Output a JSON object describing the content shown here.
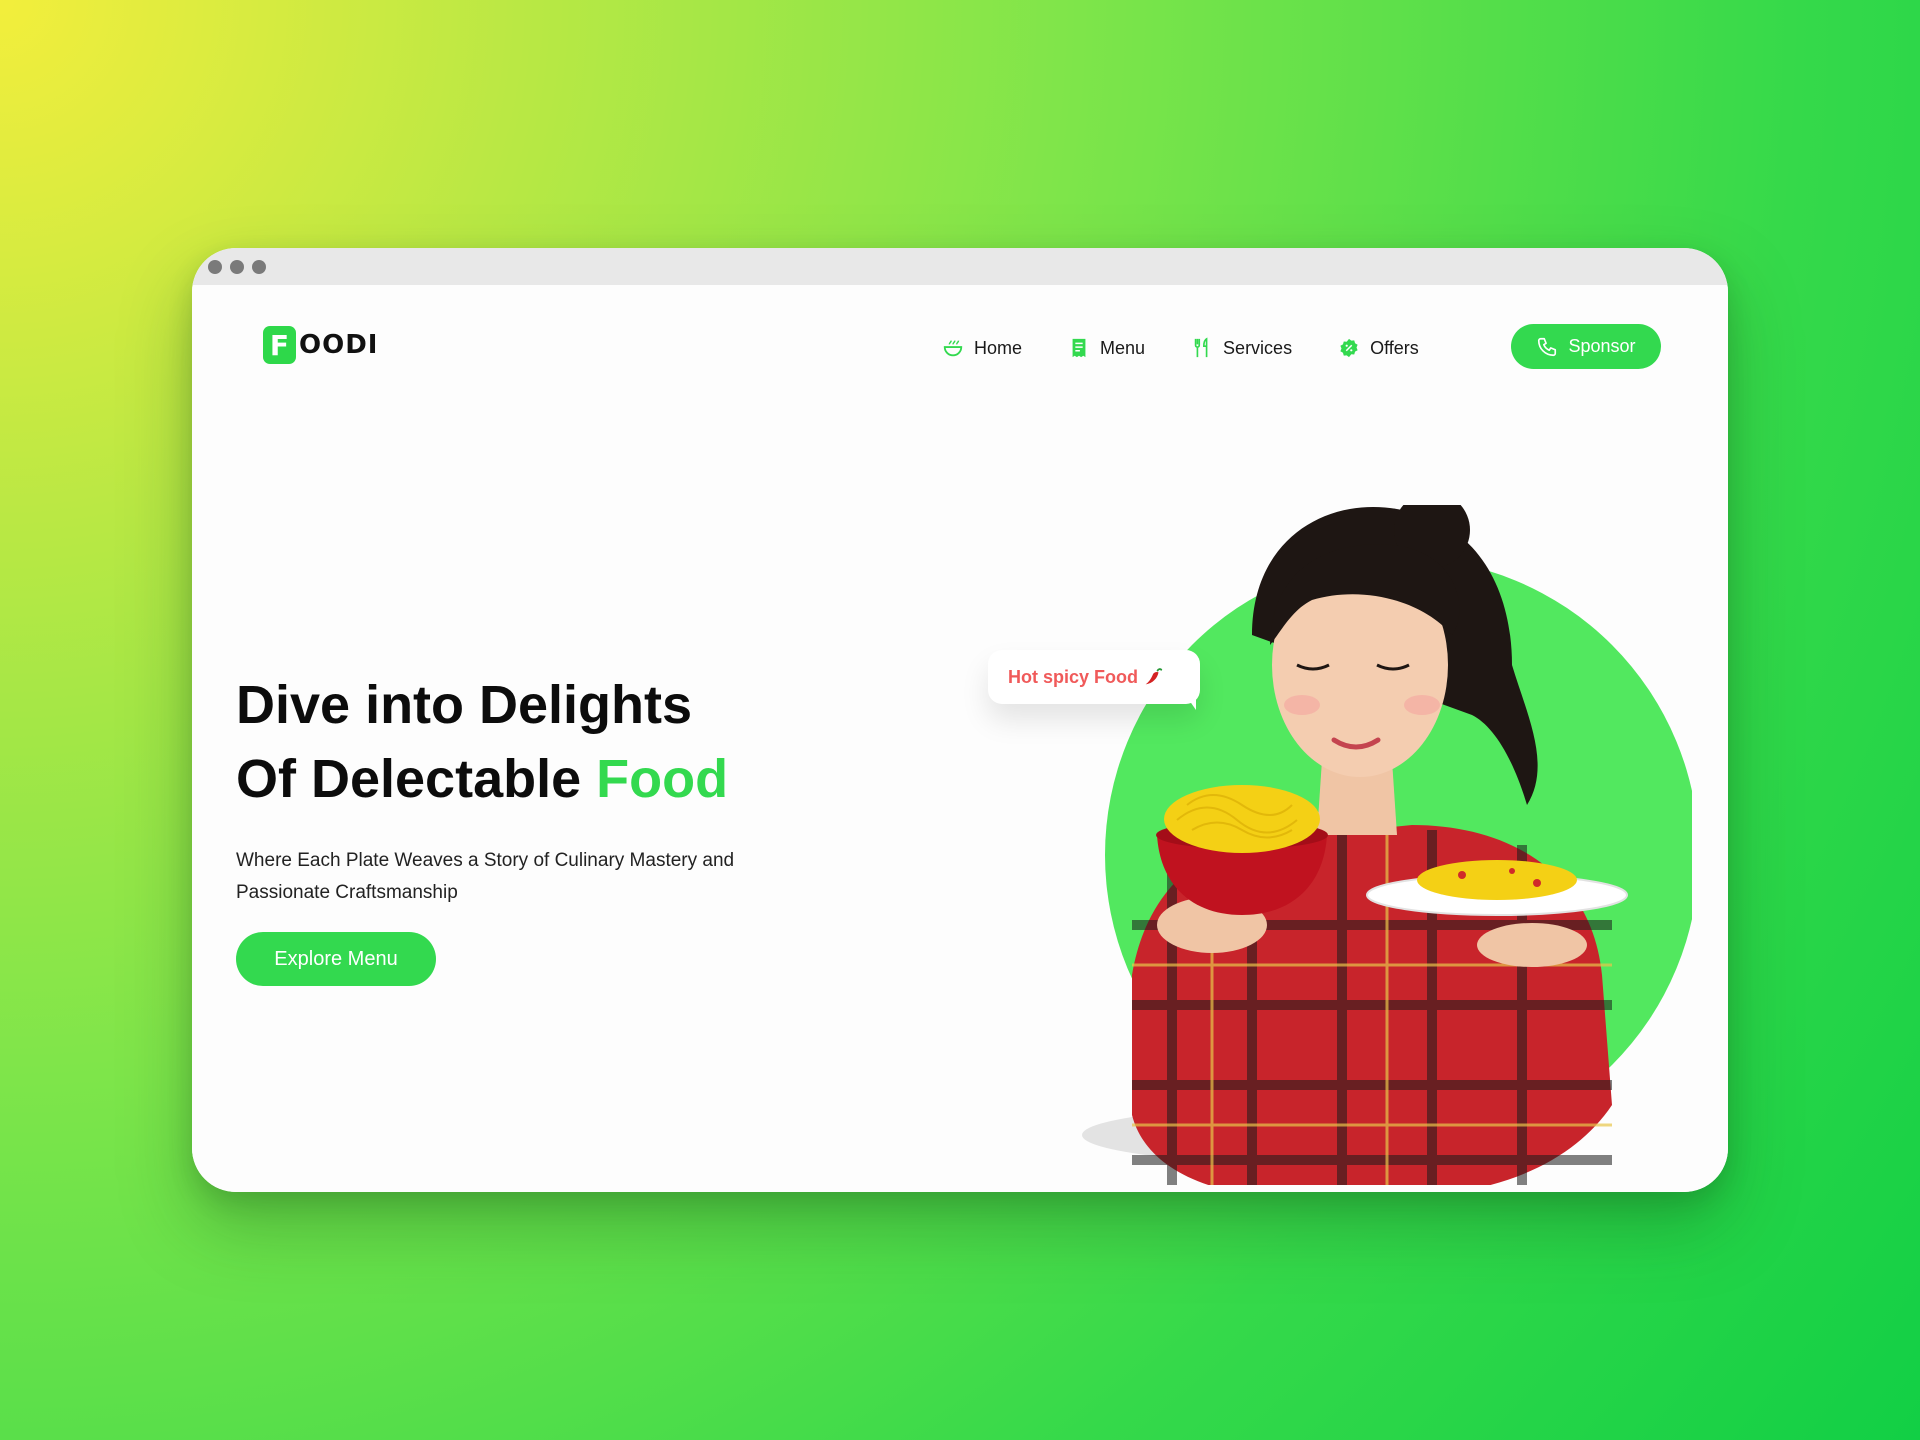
{
  "window": {
    "controls": [
      "close",
      "minimize",
      "maximize"
    ]
  },
  "brand": {
    "badge": "F",
    "name": "OODI",
    "color": "#33d94f"
  },
  "nav": {
    "items": [
      {
        "label": "Home",
        "icon": "bowl-icon"
      },
      {
        "label": "Menu",
        "icon": "receipt-icon"
      },
      {
        "label": "Services",
        "icon": "fork-knife-icon"
      },
      {
        "label": "Offers",
        "icon": "discount-badge-icon"
      }
    ],
    "cta": {
      "label": "Sponsor",
      "icon": "phone-icon"
    }
  },
  "hero": {
    "title_line1": "Dive into Delights",
    "title_line2_prefix": "Of Delectable ",
    "title_accent": "Food",
    "subtitle": "Where Each Plate Weaves a Story of Culinary Mastery and Passionate Craftsmanship",
    "cta_label": "Explore Menu",
    "tag_text": "Hot spicy Food",
    "tag_icon": "chili-icon"
  },
  "colors": {
    "accent": "#33d94f",
    "tag_text": "#f05a5a",
    "background_start": "#f3ee3c",
    "background_end": "#12cf45"
  }
}
